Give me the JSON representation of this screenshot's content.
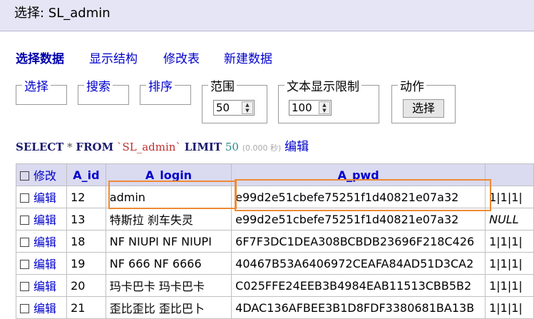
{
  "title": "选择: SL_admin",
  "nav": {
    "items": [
      "选择数据",
      "显示结构",
      "修改表",
      "新建数据"
    ]
  },
  "filters": {
    "select_label": "选择",
    "search_label": "搜索",
    "sort_label": "排序",
    "range_label": "范围",
    "range_value": "50",
    "text_limit_label": "文本显示限制",
    "text_limit_value": "100",
    "action_label": "动作",
    "action_button": "选择"
  },
  "sql": {
    "select": "SELECT",
    "star": "*",
    "from": "FROM",
    "table": "`SL_admin`",
    "limit": "LIMIT",
    "limit_value": "50",
    "time": "(0.000 秒)",
    "edit": "编辑"
  },
  "table": {
    "headers": [
      "修改",
      "A_id",
      "A_login",
      "A_pwd",
      ""
    ],
    "edit_label": "编辑",
    "rows": [
      {
        "id": "12",
        "login": "admin",
        "pwd": "e99d2e51cbefe75251f1d40821e07a32",
        "extra": "1|1|1|"
      },
      {
        "id": "13",
        "login": "特斯拉 刹车失灵",
        "pwd": "e99d2e51cbefe75251f1d40821e07a32",
        "extra": "NULL"
      },
      {
        "id": "18",
        "login": "NF NIUPI   NF  NIUPI",
        "pwd": "6F7F3DC1DEA308BCBDB23696F218C426",
        "extra": "1|1|1|"
      },
      {
        "id": "19",
        "login": "NF 666  NF  6666",
        "pwd": "40467B53A6406972CEAFA84AD51D3CA2",
        "extra": "1|1|1|"
      },
      {
        "id": "20",
        "login": "玛卡巴卡 玛卡巴卡",
        "pwd": "C025FFE24EEB3B4984EAB11513CBB5B2",
        "extra": "1|1|1|"
      },
      {
        "id": "21",
        "login": "歪比歪比 歪比巴卜",
        "pwd": "4DAC136AFBEE3B1D8FDF3380681BA13B",
        "extra": "1|1|1|"
      }
    ]
  },
  "colors": {
    "header_bg": "#dadaf0",
    "link": "#0000cc",
    "highlight": "#ef8a35",
    "titlebar_bg": "#e5e5f5"
  }
}
